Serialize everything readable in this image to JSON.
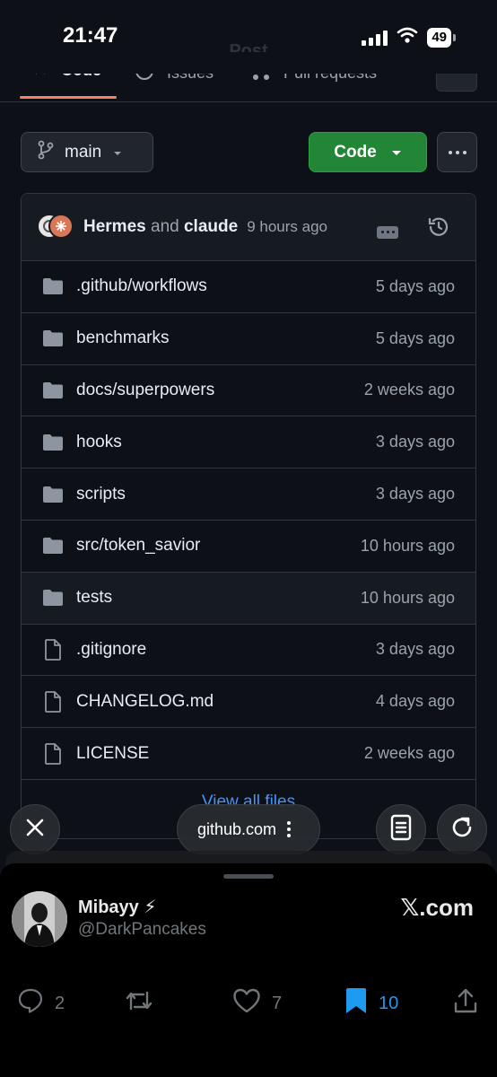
{
  "status_bar": {
    "time": "21:47",
    "battery": "49"
  },
  "repo_tabs": {
    "title": "Post",
    "tabs": [
      "Code",
      "Issues",
      "Pull requests"
    ]
  },
  "branch": {
    "name": "main"
  },
  "code_button": {
    "label": "Code"
  },
  "latest_commit": {
    "author1": "Hermes",
    "joiner": "and",
    "author2": "claude",
    "time": "9 hours ago"
  },
  "files": [
    {
      "name": ".github/workflows",
      "type": "folder",
      "date": "5 days ago"
    },
    {
      "name": "benchmarks",
      "type": "folder",
      "date": "5 days ago"
    },
    {
      "name": "docs/superpowers",
      "type": "folder",
      "date": "2 weeks ago"
    },
    {
      "name": "hooks",
      "type": "folder",
      "date": "3 days ago"
    },
    {
      "name": "scripts",
      "type": "folder",
      "date": "3 days ago"
    },
    {
      "name": "src/token_savior",
      "type": "folder",
      "date": "10 hours ago"
    },
    {
      "name": "tests",
      "type": "folder",
      "date": "10 hours ago"
    },
    {
      "name": ".gitignore",
      "type": "file",
      "date": "3 days ago"
    },
    {
      "name": "CHANGELOG.md",
      "type": "file",
      "date": "4 days ago"
    },
    {
      "name": "LICENSE",
      "type": "file",
      "date": "2 weeks ago"
    }
  ],
  "view_all": "View all files",
  "browser": {
    "url": "github.com"
  },
  "x_post": {
    "display_name": "Mibayy ⚡",
    "handle": "@DarkPancakes",
    "brand": "𝕏.com",
    "replies": "2",
    "reposts": "",
    "likes": "7",
    "bookmarks": "10"
  },
  "colors": {
    "accent_green": "#238636",
    "link_blue": "#4493f8",
    "bookmark_blue": "#1d9bf0",
    "tab_underline": "#f78166"
  }
}
